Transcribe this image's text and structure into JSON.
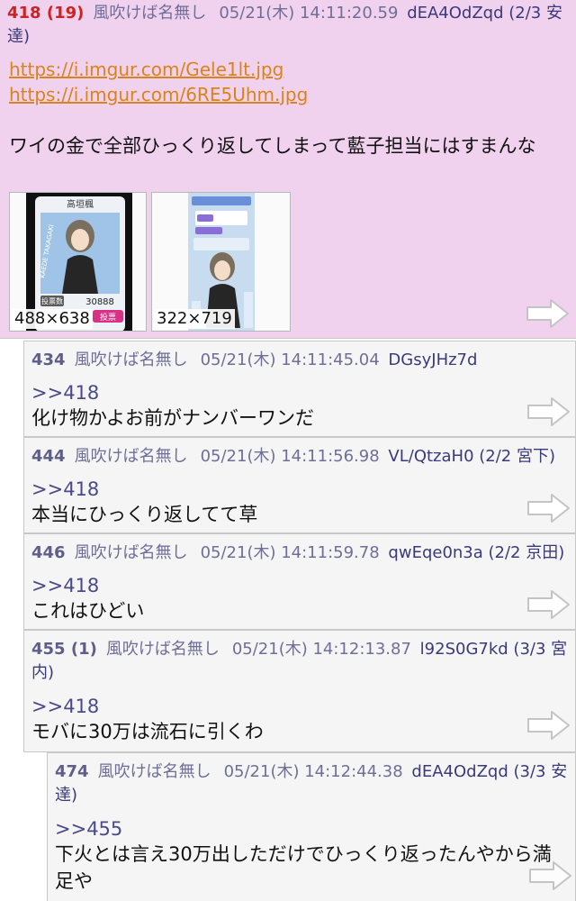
{
  "posts": [
    {
      "number": "418 (19)",
      "name": "風吹けば名無し",
      "date": "05/21(木) 14:11:20.59",
      "id": "dEA4OdZqd (2/3 安達)",
      "links": [
        "https://i.imgur.com/Gele1lt.jpg",
        "https://i.imgur.com/6RE5Uhm.jpg"
      ],
      "body": "ワイの金で全部ひっくり返してしまって藍子担当にはすまんな",
      "thumbs": [
        {
          "dims": "488×638",
          "card_name": "高垣楓",
          "card_sign": "KAEDE TAKAGAKI",
          "vote_label": "投票数",
          "vote_count": "30888",
          "vote_button": "投票"
        },
        {
          "dims": "322×719"
        }
      ]
    },
    {
      "number": "434",
      "name": "風吹けば名無し",
      "date": "05/21(木) 14:11:45.04",
      "id": "DGsyJHz7d",
      "anchor": ">>418",
      "body": "化け物かよお前がナンバーワンだ"
    },
    {
      "number": "444",
      "name": "風吹けば名無し",
      "date": "05/21(木) 14:11:56.98",
      "id": "VL/QtzaH0 (2/2 宮下)",
      "anchor": ">>418",
      "body": "本当にひっくり返してて草"
    },
    {
      "number": "446",
      "name": "風吹けば名無し",
      "date": "05/21(木) 14:11:59.78",
      "id": "qwEqe0n3a (2/2 京田)",
      "anchor": ">>418",
      "body": "これはひどい"
    },
    {
      "number": "455 (1)",
      "name": "風吹けば名無し",
      "date": "05/21(木) 14:12:13.87",
      "id": "l92S0G7kd (3/3 宮内)",
      "anchor": ">>418",
      "body": "モバに30万は流石に引くわ"
    },
    {
      "number": "474",
      "name": "風吹けば名無し",
      "date": "05/21(木) 14:12:44.38",
      "id": "dEA4OdZqd (3/3 安達)",
      "anchor": ">>455",
      "body": "下火とは言え30万出しただけでひっくり返ったんやから満足や"
    }
  ],
  "colors": {
    "op_background": "#f1d2ee",
    "reply_background": "#f5f5f5",
    "link": "#d9841a",
    "post_number_highlight": "#cc2222",
    "meta_text": "#6e6e98"
  },
  "icons": {
    "reply": "reply-arrow-icon"
  }
}
